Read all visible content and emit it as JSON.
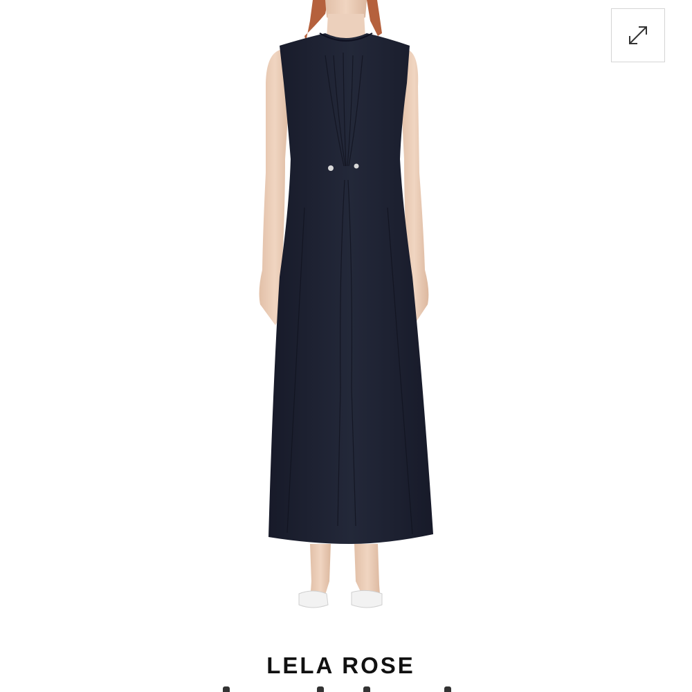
{
  "product": {
    "brand": "LELA ROSE",
    "image_description_icon": "dress-photo"
  },
  "controls": {
    "expand_icon": "expand-arrows-icon"
  },
  "colors": {
    "dress": "#1e2233",
    "background": "#ffffff",
    "brand_text": "#111111",
    "button_border": "#d4d4d4"
  }
}
